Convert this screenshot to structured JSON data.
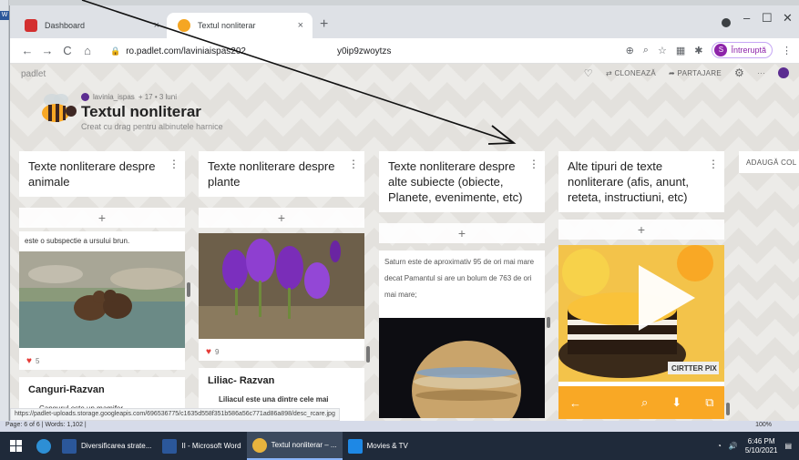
{
  "browser": {
    "tabs": [
      {
        "title": "Dashboard",
        "close": "×"
      },
      {
        "title": "Textul nonliterar",
        "close": "×"
      }
    ],
    "new_tab": "+",
    "url": "ro.padlet.com/laviniaispas202",
    "url_rest": "y0ip9zwoytzs",
    "profile_letter": "S",
    "profile_status": "Întreruptă",
    "window_min": "–",
    "window_max": "☐",
    "window_close": "✕"
  },
  "padlet": {
    "brand": "padlet",
    "actions": {
      "clone": "CLONEAZĂ",
      "share": "PARTAJARE"
    },
    "author": "lavinia_ispas",
    "meta": "+ 17 • 3 luni",
    "title": "Textul nonliterar",
    "subtitle": "Creat cu drag pentru albinutele harnice",
    "add_column": "ADAUGĂ COL",
    "columns": [
      {
        "title": "Texte nonliterare despre animale",
        "add": "+",
        "post1_text": "este o subspectie a ursului brun.",
        "post1_likes": "5",
        "post2_title": "Canguri-Razvan",
        "post2_text": "Cangurul este un mamifer"
      },
      {
        "title": "Texte nonliterare despre plante",
        "add": "+",
        "post1_likes": "9",
        "post2_title": "Liliac- Razvan",
        "post2_text": "Liliacul este una dintre cele mai frumoase flori de primavara"
      },
      {
        "title": "Texte nonliterare despre alte subiecte (obiecte, Planete, evenimente, etc)",
        "add": "+",
        "post1_text": "Saturn este de aproximativ 95 de ori mai mare decat Pamantul si are un bolum de 763 de ori mai mare;"
      },
      {
        "title": "Alte tipuri de texte nonliterare (afis, anunt, reteta, instructiuni, etc)",
        "add": "+",
        "video_watermark": "CIRTTER PIX"
      }
    ]
  },
  "status_url": "https://padlet-uploads.storage.googleapis.com/696536775/c1635d558f351b586a56c771ad86a898/desc_rcare.jpg",
  "word_status": {
    "left": "Page: 6 of 6  |  Words: 1,102  |",
    "zoom": "100%"
  },
  "taskbar": {
    "items": [
      "Diversificarea strate...",
      "II - Microsoft Word",
      "Textul nonliterar – ...",
      "Movies & TV"
    ],
    "time": "6:46 PM",
    "date": "5/10/2021"
  },
  "colors": {
    "accent": "#f9a825",
    "heart": "#e53935",
    "taskbar": "#1f2a3a"
  }
}
